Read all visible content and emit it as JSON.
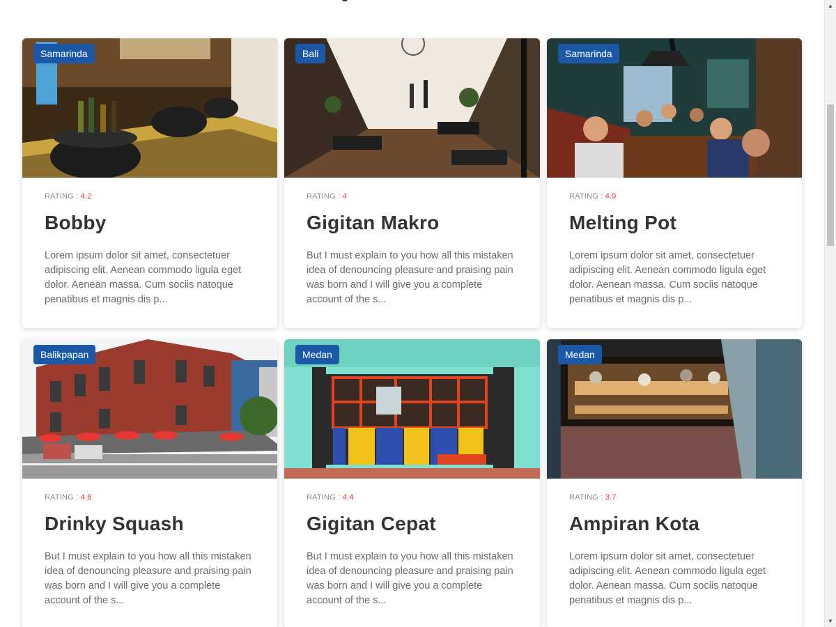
{
  "cards": [
    {
      "city": "Samarinda",
      "rating_label": "RATING :",
      "rating": "4.2",
      "title": "Bobby",
      "description": "Lorem ipsum dolor sit amet, consectetuer adipiscing elit. Aenean commodo ligula eget dolor. Aenean massa. Cum sociis natoque penatibus et magnis dis p..."
    },
    {
      "city": "Bali",
      "rating_label": "RATING :",
      "rating": "4",
      "title": "Gigitan Makro",
      "description": "But I must explain to you how all this mistaken idea of denouncing pleasure and praising pain was born and I will give you a complete account of the s..."
    },
    {
      "city": "Samarinda",
      "rating_label": "RATING :",
      "rating": "4.9",
      "title": "Melting Pot",
      "description": "Lorem ipsum dolor sit amet, consectetuer adipiscing elit. Aenean commodo ligula eget dolor. Aenean massa. Cum sociis natoque penatibus et magnis dis p..."
    },
    {
      "city": "Balikpapan",
      "rating_label": "RATING :",
      "rating": "4.8",
      "title": "Drinky Squash",
      "description": "But I must explain to you how all this mistaken idea of denouncing pleasure and praising pain was born and I will give you a complete account of the s..."
    },
    {
      "city": "Medan",
      "rating_label": "RATING :",
      "rating": "4.4",
      "title": "Gigitan Cepat",
      "description": "But I must explain to you how all this mistaken idea of denouncing pleasure and praising pain was born and I will give you a complete account of the s..."
    },
    {
      "city": "Medan",
      "rating_label": "RATING :",
      "rating": "3.7",
      "title": "Ampiran Kota",
      "description": "Lorem ipsum dolor sit amet, consectetuer adipiscing elit. Aenean commodo ligula eget dolor. Aenean massa. Cum sociis natoque penatibus et magnis dis p..."
    }
  ],
  "colors": {
    "badge": "#1b59a8",
    "rating_value": "#e53935",
    "title": "#333333"
  },
  "scrollbar": {
    "up_icon": "scroll-up-arrow-icon",
    "down_icon": "scroll-down-arrow-icon"
  }
}
